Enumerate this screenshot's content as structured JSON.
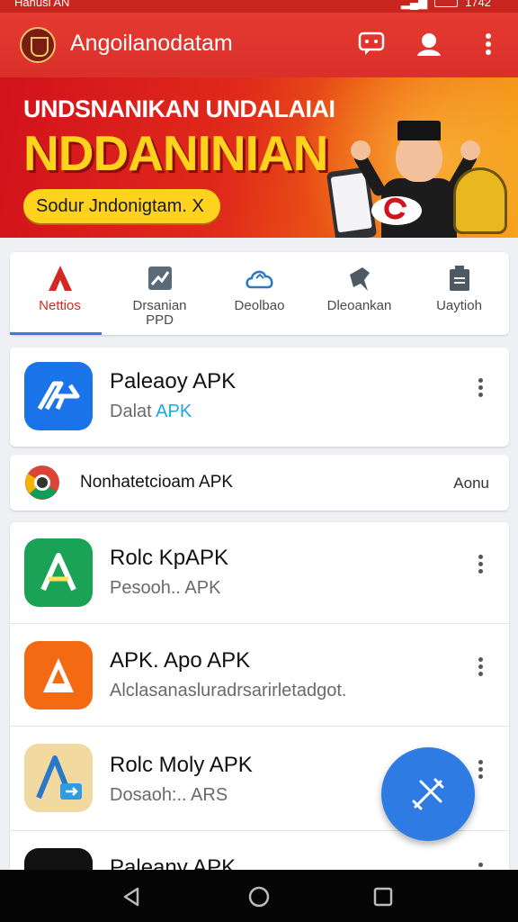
{
  "status_bar": {
    "left_text": "Hanusi AN",
    "time": "1742"
  },
  "app_bar": {
    "title": "Angoilanodatam"
  },
  "banner": {
    "headline": "UNDSNANIKAN UNDALAIAI",
    "big_text": "NDDANINIAN",
    "pill_text": "Sodur Jndonigtam. X"
  },
  "categories": [
    {
      "label": "Nettios",
      "icon": "app-store-icon",
      "active": true
    },
    {
      "label": "Drsanian\nPPD",
      "icon": "chart-icon",
      "active": false
    },
    {
      "label": "Deolbao",
      "icon": "cloud-icon",
      "active": false
    },
    {
      "label": "Dleoankan",
      "icon": "pin-icon",
      "active": false
    },
    {
      "label": "Uaytioh",
      "icon": "document-icon",
      "active": false
    }
  ],
  "featured_app": {
    "title": "Paleaoy APK",
    "subtitle_prefix": "Dalat",
    "subtitle_accent": "APK"
  },
  "promo_row": {
    "title": "Nonhatetcioam APK",
    "action": "Aonu"
  },
  "app_list": [
    {
      "title": "Rolc KpAPK",
      "subtitle": "Pesooh.. APK",
      "icon": "green-a-icon"
    },
    {
      "title": "APK. Apo APK",
      "subtitle": "Alclasanasluradrsarirletadgot.",
      "icon": "orange-a-icon"
    },
    {
      "title": "Rolc Moly APK",
      "subtitle": "Dosaoh:.. ARS",
      "icon": "blue-a-icon"
    },
    {
      "title": "Paleany APK",
      "subtitle": "",
      "icon": "dark-app-icon"
    }
  ],
  "colors": {
    "primary_red": "#d9302a",
    "accent_blue": "#2f7be4",
    "accent_cyan": "#1ea7e0",
    "banner_yellow": "#ffd21e"
  }
}
